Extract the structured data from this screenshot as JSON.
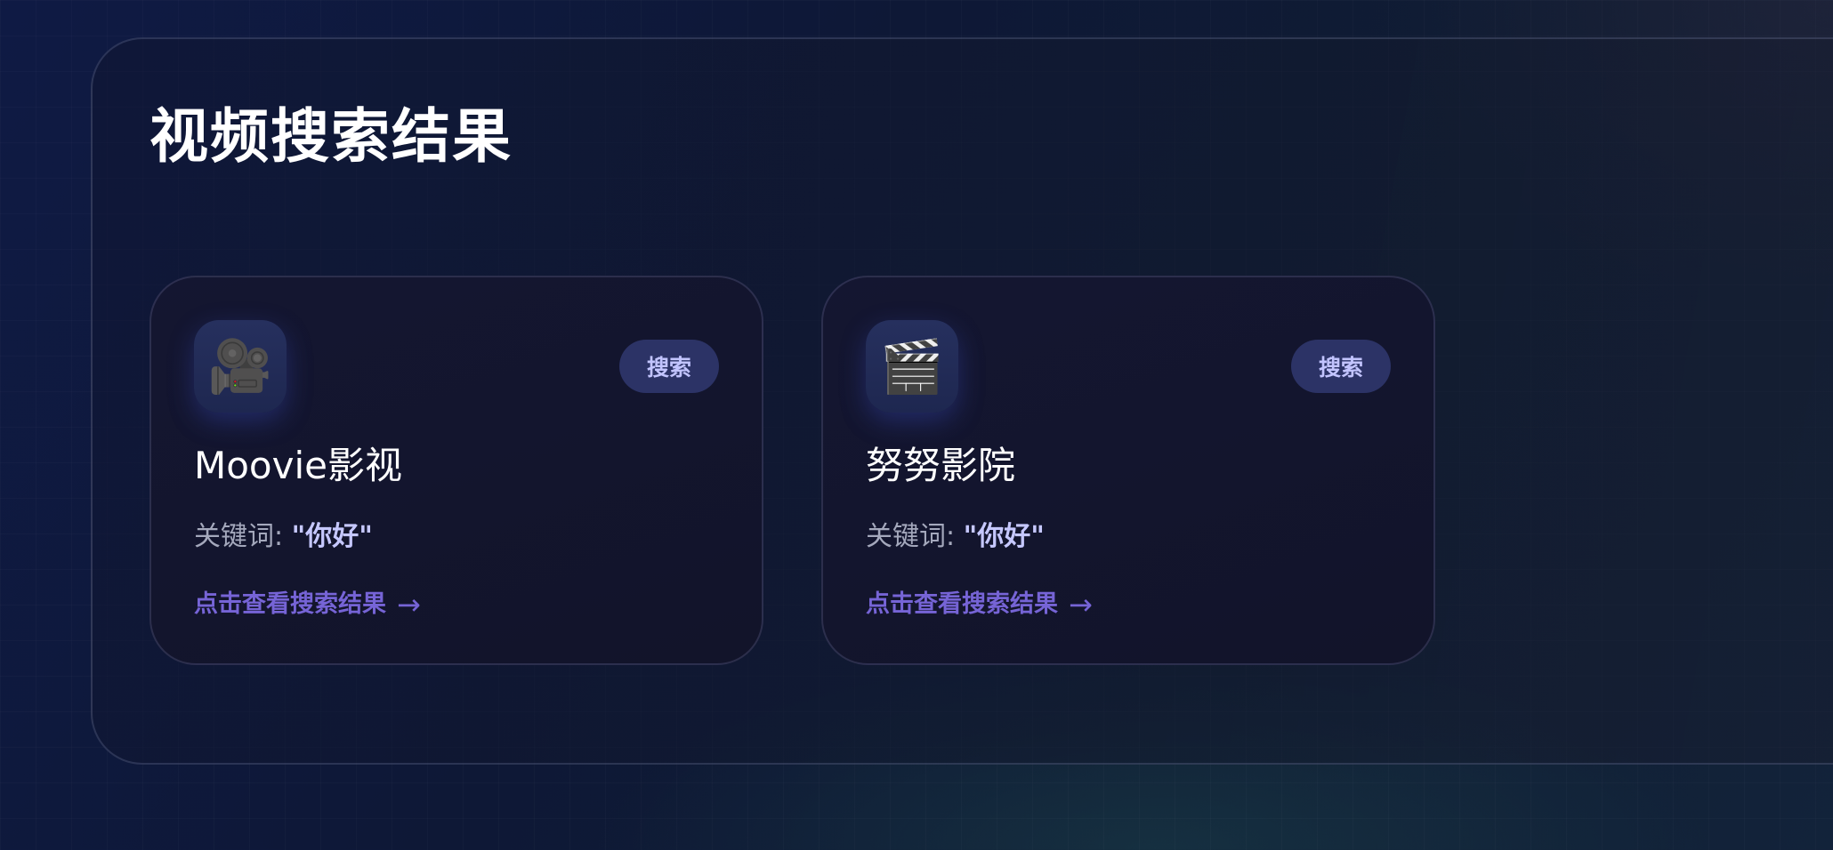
{
  "page": {
    "title": "视频搜索结果"
  },
  "results": [
    {
      "icon": "movie-camera-icon",
      "icon_glyph": "🎥",
      "name": "Moovie影视",
      "search_label": "搜索",
      "keyword_label": "关键词: ",
      "keyword_value": "\"你好\"",
      "link_text": "点击查看搜索结果",
      "link_arrow": "→"
    },
    {
      "icon": "clapper-board-icon",
      "icon_glyph": "🎬",
      "name": "努努影院",
      "search_label": "搜索",
      "keyword_label": "关键词: ",
      "keyword_value": "\"你好\"",
      "link_text": "点击查看搜索结果",
      "link_arrow": "→"
    }
  ],
  "colors": {
    "accent": "#7664d6",
    "button_bg": "#2c3366",
    "button_text": "#c2c4ff",
    "keyword_highlight": "#c6c8ff"
  }
}
